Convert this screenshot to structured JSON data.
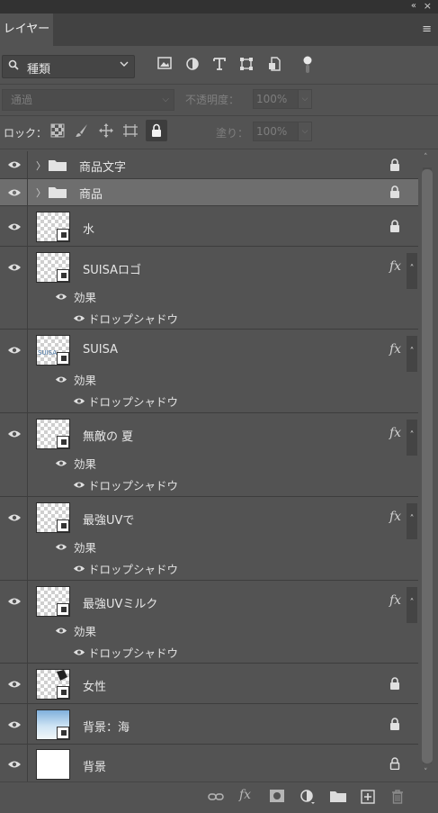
{
  "panel": {
    "tab_title": "レイヤー",
    "collapse_glyph": "«",
    "close_glyph": "×",
    "menu_glyph": "≡"
  },
  "filter": {
    "kind_label": "種類",
    "icons": [
      "image-filter-icon",
      "adjustment-filter-icon",
      "type-filter-icon",
      "shape-filter-icon",
      "smart-object-filter-icon",
      "filter-toggle-icon"
    ]
  },
  "blend": {
    "mode": "通過",
    "opacity_label": "不透明度：",
    "opacity_value": "100%",
    "fill_label": "塗り：",
    "fill_value": "100%"
  },
  "lock": {
    "label": "ロック：",
    "icons": [
      "lock-transparent-pixels-icon",
      "lock-image-pixels-icon",
      "lock-position-icon",
      "lock-artboard-icon",
      "lock-all-icon"
    ]
  },
  "layers": [
    {
      "name": "商品文字",
      "type": "group",
      "locked": true,
      "selected": false
    },
    {
      "name": "商品",
      "type": "group",
      "locked": true,
      "selected": true
    },
    {
      "name": "水",
      "type": "layer",
      "locked": true
    },
    {
      "name": "SUISAロゴ",
      "type": "layer",
      "fx": true,
      "effects_label": "効果",
      "effect": "ドロップシャドウ",
      "thumb_text": ""
    },
    {
      "name": "SUISA",
      "type": "layer",
      "fx": true,
      "effects_label": "効果",
      "effect": "ドロップシャドウ",
      "thumb_text": "SUISA"
    },
    {
      "name": "無敵の 夏",
      "type": "layer",
      "fx": true,
      "effects_label": "効果",
      "effect": "ドロップシャドウ",
      "thumb_text": ""
    },
    {
      "name": "最強UVで",
      "type": "layer",
      "fx": true,
      "effects_label": "効果",
      "effect": "ドロップシャドウ",
      "thumb_text": ""
    },
    {
      "name": "最強UVミルク",
      "type": "layer",
      "fx": true,
      "effects_label": "効果",
      "effect": "ドロップシャドウ",
      "thumb_text": ""
    },
    {
      "name": "女性",
      "type": "layer",
      "locked": true
    },
    {
      "name": "背景：海",
      "type": "layer",
      "locked": true
    },
    {
      "name": "背景",
      "type": "background",
      "locked": true
    }
  ],
  "fx_glyph": "fx",
  "footer_icons": [
    "link-layers-icon",
    "add-style-icon",
    "add-mask-icon",
    "new-fill-adjustment-icon",
    "new-group-icon",
    "new-layer-icon",
    "delete-layer-icon"
  ]
}
